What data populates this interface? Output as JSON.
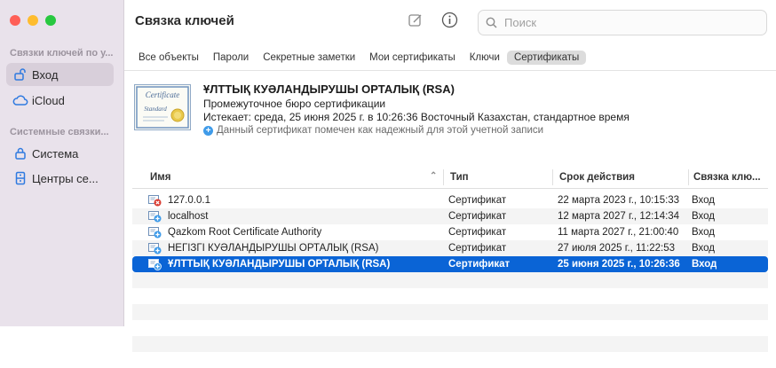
{
  "sidebar": {
    "section1": "Связки ключей по у...",
    "items1": [
      {
        "label": "Вход",
        "icon": "lock-open-icon"
      },
      {
        "label": "iCloud",
        "icon": "cloud-icon"
      }
    ],
    "section2": "Системные связки...",
    "items2": [
      {
        "label": "Система",
        "icon": "lock-icon"
      },
      {
        "label": "Центры се...",
        "icon": "cabinet-icon"
      }
    ]
  },
  "window": {
    "title": "Связка ключей"
  },
  "search": {
    "placeholder": "Поиск"
  },
  "tabs": [
    "Все объекты",
    "Пароли",
    "Секретные заметки",
    "Мои сертификаты",
    "Ключи",
    "Сертификаты"
  ],
  "active_tab": "Сертификаты",
  "certificate": {
    "icon_text_1": "Certificate",
    "icon_text_2": "Standard",
    "title": "ҰЛТТЫҚ КУӘЛАНДЫРУШЫ ОРТАЛЫҚ (RSA)",
    "subtitle": "Промежуточное бюро сертификации",
    "expires": "Истекает: среда, 25 июня 2025 г. в 10:26:36 Восточный Казахстан, стандартное время",
    "trust": "Данный сертификат помечен как надежный для этой учетной записи"
  },
  "table": {
    "columns": [
      "Имя",
      "Тип",
      "Срок действия",
      "Связка клю..."
    ],
    "rows": [
      {
        "name": "127.0.0.1",
        "type": "Сертификат",
        "expires": "22 марта 2023 г., 10:15:33",
        "keychain": "Вход",
        "status": "invalid"
      },
      {
        "name": "localhost",
        "type": "Сертификат",
        "expires": "12 марта 2027 г., 12:14:34",
        "keychain": "Вход",
        "status": "trusted"
      },
      {
        "name": "Qazkom Root Certificate Authority",
        "type": "Сертификат",
        "expires": "11 марта 2027 г., 21:00:40",
        "keychain": "Вход",
        "status": "trusted"
      },
      {
        "name": "НЕГІЗГІ КУӘЛАНДЫРУШЫ ОРТАЛЫҚ (RSA)",
        "type": "Сертификат",
        "expires": "27 июля 2025 г., 11:22:53",
        "keychain": "Вход",
        "status": "trusted"
      },
      {
        "name": "ҰЛТТЫҚ КУӘЛАНДЫРУШЫ ОРТАЛЫҚ (RSA)",
        "type": "Сертификат",
        "expires": "25 июня 2025 г., 10:26:36",
        "keychain": "Вход",
        "status": "trusted",
        "selected": true
      }
    ]
  }
}
